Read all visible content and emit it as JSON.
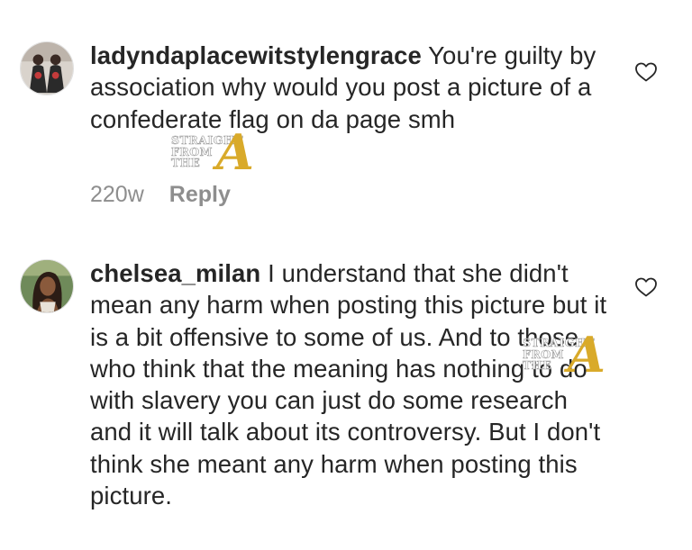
{
  "comments": [
    {
      "username": "ladyndaplacewitstylengrace",
      "text": "You're guilty by association why would you post a picture of a confederate flag on da page smh",
      "time": "220w",
      "reply_label": "Reply"
    },
    {
      "username": "chelsea_milan",
      "text": "I understand that she didn't mean any harm when posting this picture but it is a bit offensive to some of us. And to those who think that the meaning has nothing to do with slavery you can just do some research and it will talk about its controversy. But I don't think she meant any harm when posting this picture."
    }
  ],
  "watermark": {
    "line1": "STRAIGHT",
    "line2": "FROM",
    "line3": "THE",
    "letter": "A",
    "color": "#d9aa2a"
  },
  "colors": {
    "text": "#262626",
    "meta": "#8e8e8e",
    "heart_outline": "#262626"
  },
  "icons": {
    "like": "heart-outline-icon"
  }
}
